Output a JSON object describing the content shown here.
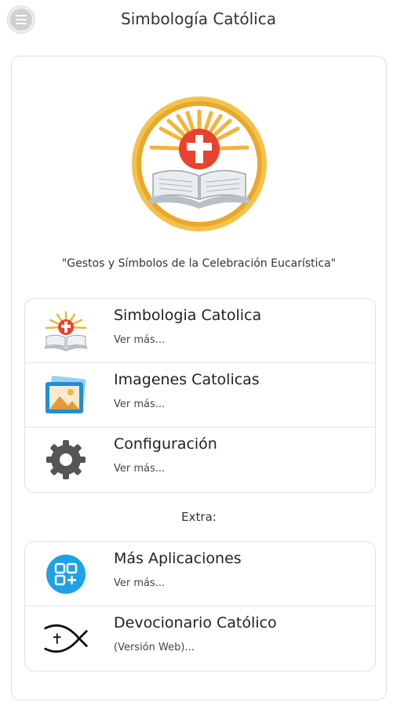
{
  "header": {
    "title": "Simbología Católica",
    "menu_icon": "hamburger-menu-icon"
  },
  "main": {
    "logo_icon": "catholic-cross-bible-emblem",
    "tagline": "\"Gestos y Símbolos de la Celebración Eucarística\"",
    "items": [
      {
        "title": "Simbologia Catolica",
        "subtitle": "Ver más...",
        "icon": "cross-bible-icon"
      },
      {
        "title": "Imagenes Catolicas",
        "subtitle": "Ver más...",
        "icon": "picture-icon"
      },
      {
        "title": "Configuración",
        "subtitle": "Ver más...",
        "icon": "gear-icon"
      }
    ]
  },
  "extra": {
    "label": "Extra:",
    "items": [
      {
        "title": "Más Aplicaciones",
        "subtitle": "Ver más...",
        "icon": "apps-grid-icon"
      },
      {
        "title": "Devocionario Católico",
        "subtitle": "(Versión Web)...",
        "icon": "ichthys-fish-icon"
      }
    ]
  },
  "colors": {
    "gold": "#e9a82a",
    "red": "#e8432e",
    "blue": "#1ea1e6",
    "gear": "#555555"
  }
}
